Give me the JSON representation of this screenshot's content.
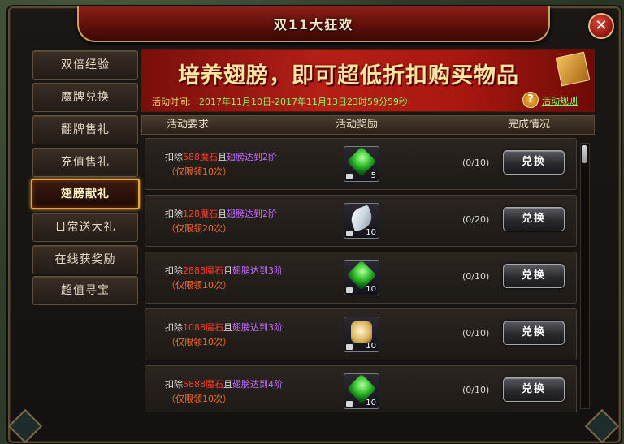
{
  "window": {
    "title": "双11大狂欢"
  },
  "sidebar": {
    "items": [
      {
        "label": "双倍经验"
      },
      {
        "label": "魔牌兑换"
      },
      {
        "label": "翻牌售礼"
      },
      {
        "label": "充值售礼"
      },
      {
        "label": "翅膀献礼",
        "active": true
      },
      {
        "label": "日常送大礼"
      },
      {
        "label": "在线获奖励"
      },
      {
        "label": "超值寻宝"
      }
    ]
  },
  "banner": {
    "title": "培养翅膀，即可超低折扣购买物品",
    "time_label": "活动时间:",
    "time_value": "2017年11月10日-2017年11月13日23时59分59秒",
    "rules_link": "活动规则",
    "help_icon": "?"
  },
  "table": {
    "headers": [
      "活动要求",
      "活动奖励",
      "完成情况"
    ],
    "rows": [
      {
        "req_prefix": "扣除",
        "cost": "588魔石",
        "mid": "且",
        "cond": "翅膀达到2阶",
        "limit": "（仅限领10次）",
        "item_icon": "green-gem-icon",
        "item_count": "5",
        "progress": "(0/10)",
        "button": "兑换"
      },
      {
        "req_prefix": "扣除",
        "cost": "128魔石",
        "mid": "且",
        "cond": "翅膀达到2阶",
        "limit": "（仅限领20次）",
        "item_icon": "feather-icon",
        "item_count": "10",
        "progress": "(0/20)",
        "button": "兑换"
      },
      {
        "req_prefix": "扣除",
        "cost": "2888魔石",
        "mid": "且",
        "cond": "翅膀达到3阶",
        "limit": "（仅限领10次）",
        "item_icon": "green-gem-icon",
        "item_count": "10",
        "progress": "(0/10)",
        "button": "兑换"
      },
      {
        "req_prefix": "扣除",
        "cost": "1088魔石",
        "mid": "且",
        "cond": "翅膀达到3阶",
        "limit": "（仅限领10次）",
        "item_icon": "scroll-icon",
        "item_count": "10",
        "progress": "(0/10)",
        "button": "兑换"
      },
      {
        "req_prefix": "扣除",
        "cost": "5888魔石",
        "mid": "且",
        "cond": "翅膀达到4阶",
        "limit": "（仅限领10次）",
        "item_icon": "green-gem-icon",
        "item_count": "10",
        "progress": "(0/10)",
        "button": "兑换"
      }
    ]
  },
  "close_button": "✕"
}
